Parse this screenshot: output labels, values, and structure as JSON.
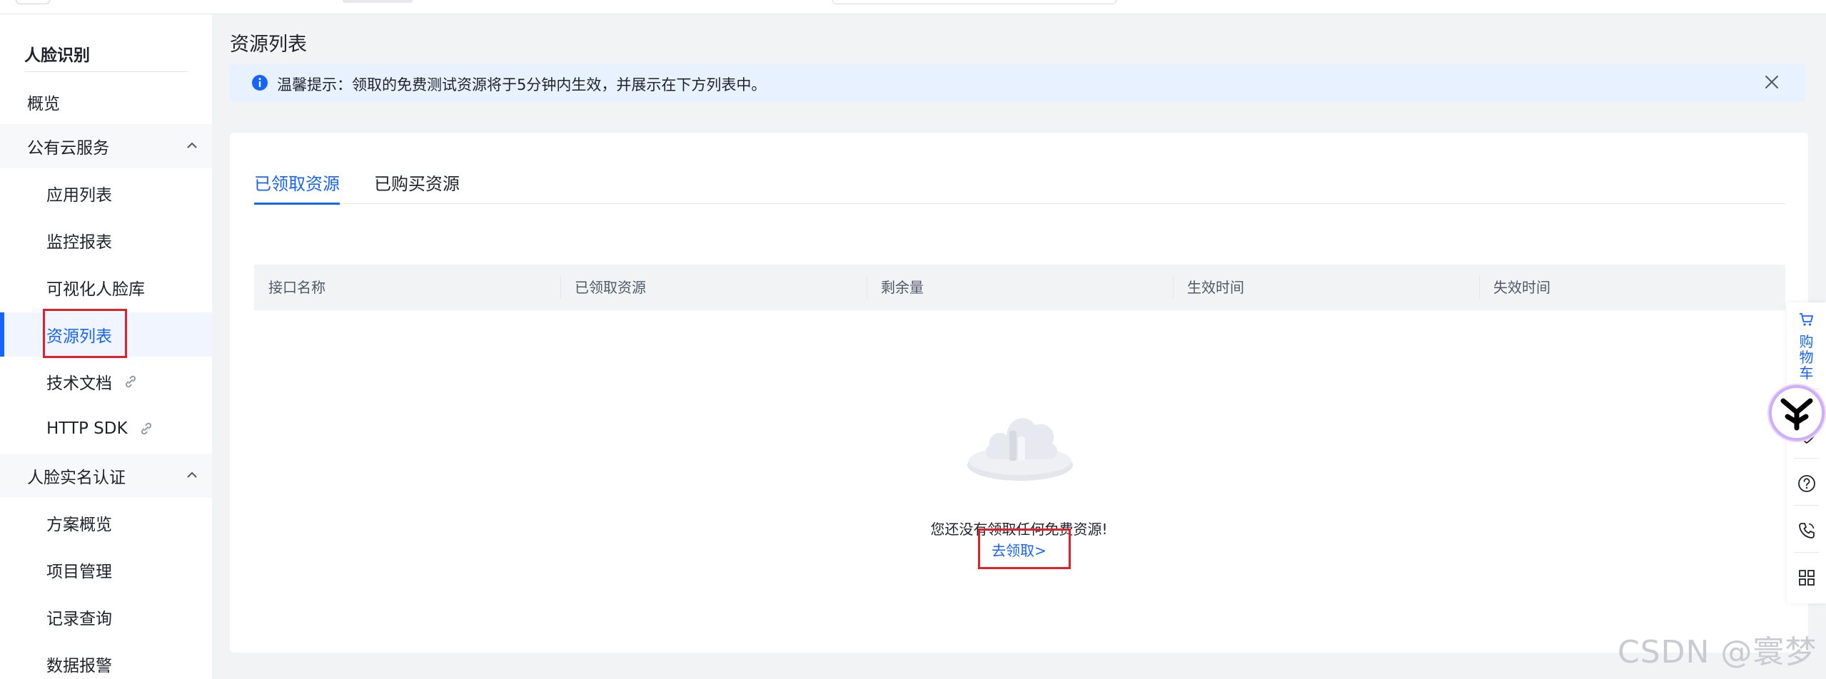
{
  "sidebar": {
    "brand": "人脸识别",
    "overview": "概览",
    "groups": [
      {
        "label": "公有云服务",
        "items": [
          "应用列表",
          "监控报表",
          "可视化人脸库",
          "资源列表",
          "技术文档",
          "HTTP SDK"
        ]
      },
      {
        "label": "人脸实名认证",
        "items": [
          "方案概览",
          "项目管理",
          "记录查询",
          "数据报警"
        ]
      }
    ],
    "active_item": "资源列表"
  },
  "main": {
    "title": "资源列表",
    "notice": "温馨提示：领取的免费测试资源将于5分钟内生效，并展示在下方列表中。",
    "tabs": [
      {
        "label": "已领取资源",
        "active": true
      },
      {
        "label": "已购买资源",
        "active": false
      }
    ],
    "table": {
      "columns": [
        "接口名称",
        "已领取资源",
        "剩余量",
        "生效时间",
        "失效时间"
      ],
      "rows": []
    },
    "empty": {
      "text": "您还没有领取任何免费资源!",
      "link": "去领取>"
    }
  },
  "float_bar": {
    "cart_label": "购物车"
  },
  "watermark": "CSDN @寰梦",
  "colors": {
    "accent": "#1664ff",
    "highlight_box": "#e0202b",
    "notice_bg": "#e8f1ff"
  }
}
